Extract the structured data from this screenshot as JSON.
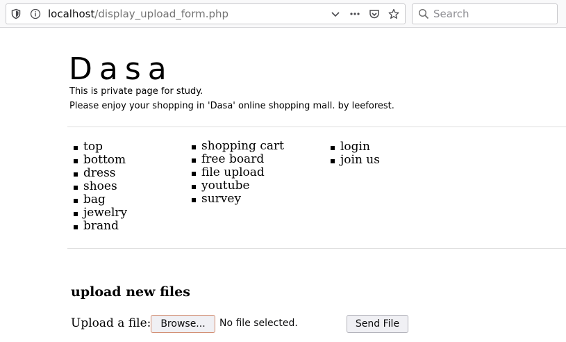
{
  "browser": {
    "url_host": "localhost",
    "url_path": "/display_upload_form.php",
    "search_placeholder": "Search"
  },
  "site": {
    "logo": "Dasa",
    "tagline_1": "This is private page for study.",
    "tagline_2": "Please enjoy your shopping in 'Dasa' online shopping mall. by leeforest."
  },
  "menu": {
    "categories": [
      "top",
      "bottom",
      "dress",
      "shoes",
      "bag",
      "jewelry",
      "brand"
    ],
    "services": [
      "shopping cart",
      "free board",
      "file upload",
      "youtube",
      "survey"
    ],
    "account": [
      "login",
      "join us"
    ]
  },
  "upload": {
    "heading": "upload new files",
    "label": "Upload a file:",
    "browse_label": "Browse...",
    "status": "No file selected.",
    "send_label": "Send File"
  }
}
